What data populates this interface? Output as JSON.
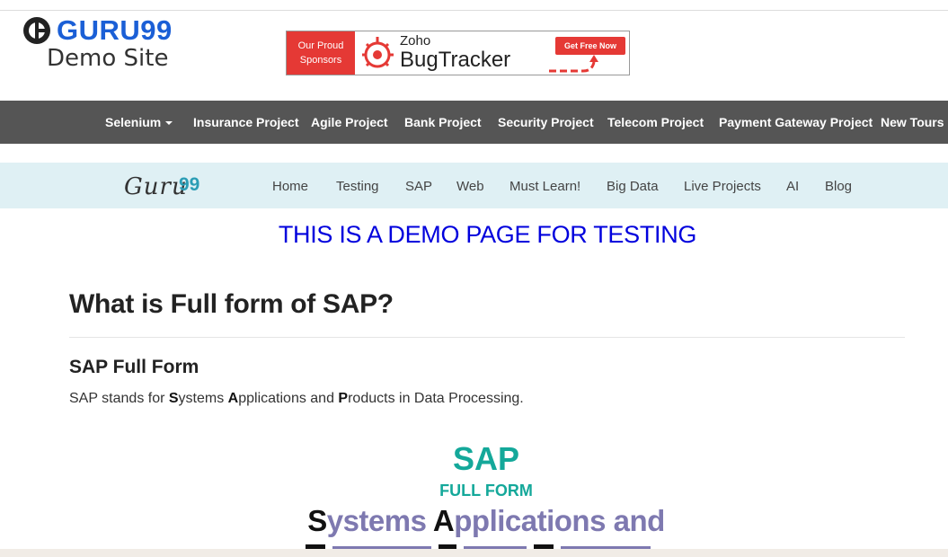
{
  "header": {
    "brand_name": "GURU99",
    "brand_sub": "Demo Site",
    "sponsor": {
      "left_line1": "Our Proud",
      "left_line2": "Sponsors",
      "company": "Zoho",
      "product": "BugTracker",
      "cta": "Get Free Now"
    }
  },
  "dark_nav": {
    "items": [
      {
        "label": "Selenium",
        "dropdown": true
      },
      {
        "label": "Insurance Project"
      },
      {
        "label": "Agile Project"
      },
      {
        "label": "Bank Project"
      },
      {
        "label": "Security Project"
      },
      {
        "label": "Telecom Project"
      },
      {
        "label": "Payment Gateway Project"
      },
      {
        "label": "New Tours"
      }
    ]
  },
  "light_nav": {
    "logo_text": "Guru",
    "logo_num": "99",
    "items": [
      {
        "label": "Home"
      },
      {
        "label": "Testing"
      },
      {
        "label": "SAP"
      },
      {
        "label": "Web"
      },
      {
        "label": "Must Learn!"
      },
      {
        "label": "Big Data"
      },
      {
        "label": "Live Projects"
      },
      {
        "label": "AI"
      },
      {
        "label": "Blog"
      }
    ]
  },
  "content": {
    "banner": "THIS IS A DEMO PAGE FOR TESTING",
    "heading": "What is Full form of SAP?",
    "subheading": "SAP Full Form",
    "para_prefix": "SAP stands for ",
    "para_s": "S",
    "para_ystems": "ystems ",
    "para_a": "A",
    "para_pplications": "pplications and ",
    "para_p": "P",
    "para_roducts": "roducts in Data Processing.",
    "graphic_title": "SAP",
    "graphic_sub": "FULL FORM",
    "graphic_s": "S",
    "graphic_ystems": "ystems ",
    "graphic_a": "A",
    "graphic_pplications": "pplications and"
  },
  "colors": {
    "brand_blue": "#1b5fd6",
    "dark_nav_bg": "#555555",
    "light_nav_bg": "#dff0f4",
    "banner_blue": "#0000dd",
    "sap_teal": "#14a89a",
    "sap_purple": "#7e79b0",
    "sponsor_red": "#e53935"
  }
}
